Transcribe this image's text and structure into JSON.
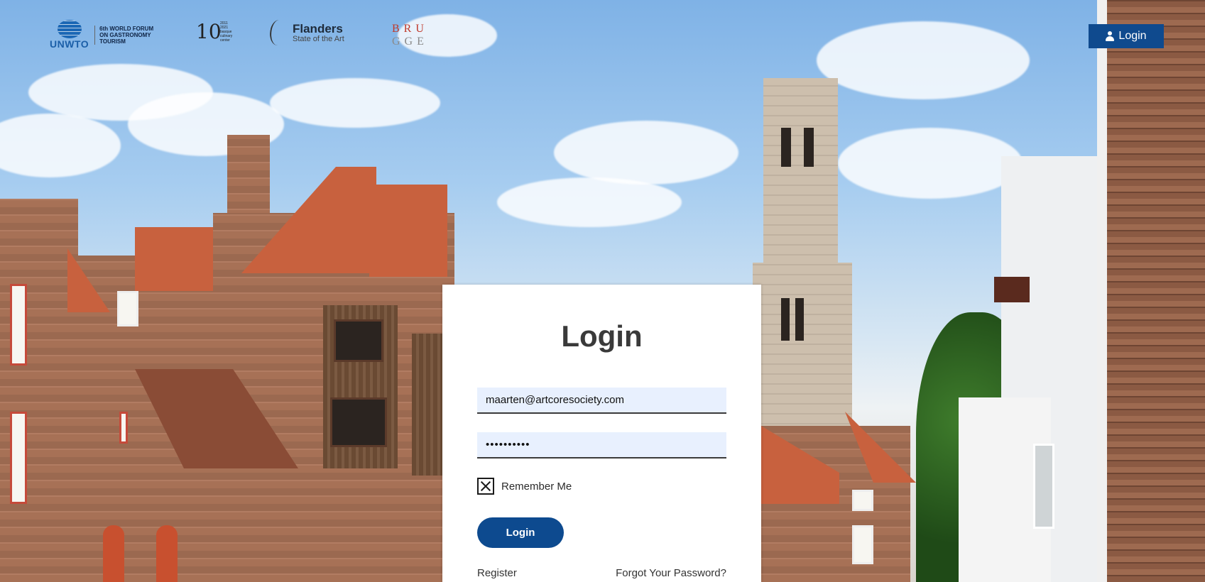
{
  "header": {
    "logos": {
      "unwto": {
        "mark": "UNWTO",
        "lines": [
          "6th WORLD FORUM",
          "ON GASTRONOMY",
          "TOURISM"
        ]
      },
      "bcc": {
        "mark": "10",
        "lines": [
          "2011",
          "2021",
          "basque",
          "culinary",
          "center"
        ]
      },
      "flanders": {
        "title": "Flanders",
        "subtitle": "State of the Art"
      },
      "brugge": {
        "row1": "BRU",
        "row2": "GGE"
      }
    },
    "login_button": {
      "label": "Login",
      "icon": "user-icon"
    }
  },
  "login_card": {
    "title": "Login",
    "email_value": "maarten@artcoresociety.com",
    "password_value": "••••••••••",
    "remember_label": "Remember Me",
    "remember_checked": true,
    "submit_label": "Login",
    "register_link": "Register",
    "forgot_link": "Forgot Your Password?"
  },
  "colors": {
    "primary": "#0d4a8f",
    "field_bg": "#e8f0fe",
    "title": "#3a3a3a",
    "brugge_red": "#c0392b",
    "brugge_grey": "#8a8a8a"
  }
}
